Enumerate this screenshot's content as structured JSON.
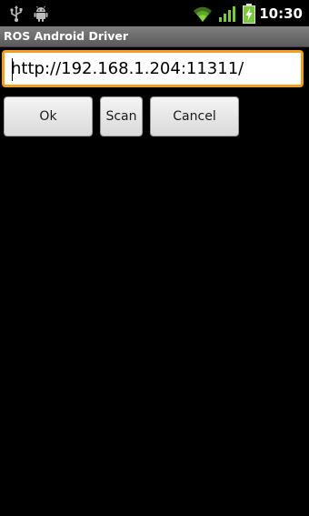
{
  "status_bar": {
    "time": "10:30",
    "icons": [
      "usb-icon",
      "android-icon",
      "wifi-icon",
      "signal-icon",
      "battery-icon"
    ]
  },
  "app": {
    "title": "ROS Android Driver"
  },
  "master_uri": {
    "value": "http://192.168.1.204:11311/"
  },
  "buttons": {
    "ok": "Ok",
    "scan": "Scan",
    "cancel": "Cancel"
  },
  "colors": {
    "focus_border": "#f39e1e",
    "title_bar": "#6b6b6b",
    "background": "#000000"
  }
}
